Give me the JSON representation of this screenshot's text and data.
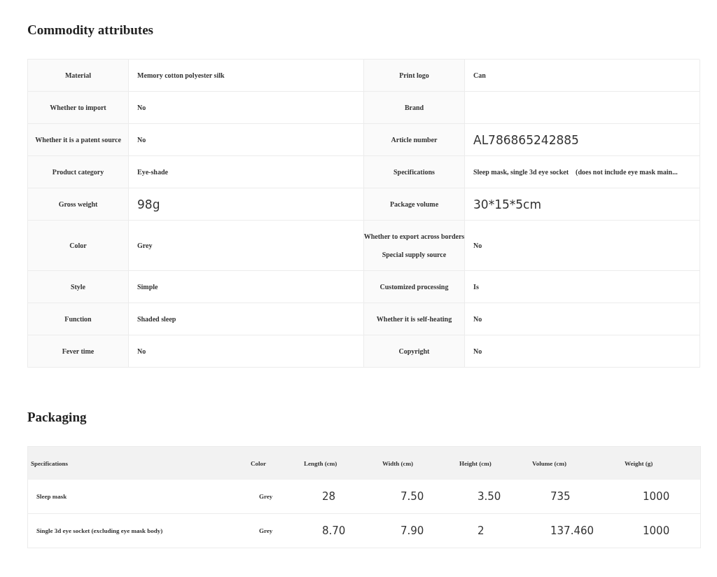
{
  "attributes": {
    "title": "Commodity attributes",
    "rows": [
      {
        "left": {
          "labels": [
            "Material"
          ],
          "value": "Memory cotton polyester silk",
          "kind": "text"
        },
        "right": {
          "labels": [
            "Print logo"
          ],
          "value": "Can",
          "kind": "text"
        }
      },
      {
        "left": {
          "labels": [
            "Whether to import"
          ],
          "value": "No",
          "kind": "text"
        },
        "right": {
          "labels": [
            "Brand"
          ],
          "kind": "empty"
        }
      },
      {
        "left": {
          "labels": [
            "Whether it is a patent source"
          ],
          "value": "No",
          "kind": "text"
        },
        "right": {
          "labels": [
            "Article number"
          ],
          "value": "AL786865242885",
          "kind": "large"
        }
      },
      {
        "left": {
          "labels": [
            "Product category"
          ],
          "value": "Eye-shade",
          "kind": "text"
        },
        "right": {
          "labels": [
            "Specifications"
          ],
          "value": "Sleep mask, single 3d eye socket    (does not include eye mask main...",
          "kind": "text"
        }
      },
      {
        "left": {
          "labels": [
            "Gross weight"
          ],
          "value": "98g",
          "kind": "large"
        },
        "right": {
          "labels": [
            "Package volume"
          ],
          "value": "30*15*5cm",
          "kind": "large"
        }
      },
      {
        "left": {
          "labels": [
            "Color"
          ],
          "value": "Grey",
          "kind": "text"
        },
        "right": {
          "labels": [
            "Whether to export across borders",
            "Special supply source"
          ],
          "value": "No",
          "kind": "text"
        }
      },
      {
        "left": {
          "labels": [
            "Style"
          ],
          "value": "Simple",
          "kind": "text"
        },
        "right": {
          "labels": [
            "Customized processing"
          ],
          "value": "Is",
          "kind": "text"
        }
      },
      {
        "left": {
          "labels": [
            "Function"
          ],
          "value": "Shaded sleep",
          "kind": "text"
        },
        "right": {
          "labels": [
            "Whether it is self-heating"
          ],
          "value": "No",
          "kind": "text"
        }
      },
      {
        "left": {
          "labels": [
            "Fever time"
          ],
          "value": "No",
          "kind": "text"
        },
        "right": {
          "labels": [
            "Copyright"
          ],
          "value": "No",
          "kind": "text"
        }
      }
    ]
  },
  "packaging": {
    "title": "Packaging",
    "columns": [
      "Specifications",
      "Color",
      "Length (cm)",
      "Width (cm)",
      "Height (cm)",
      "Volume (cm)",
      "Weight (g)"
    ],
    "rows": [
      [
        "Sleep mask",
        "Grey",
        "28",
        "7.50",
        "3.50",
        "735",
        "1000"
      ],
      [
        "Single 3d eye socket (excluding eye mask body)",
        "Grey",
        "8.70",
        "7.90",
        "2",
        "137.460",
        "1000"
      ]
    ]
  }
}
